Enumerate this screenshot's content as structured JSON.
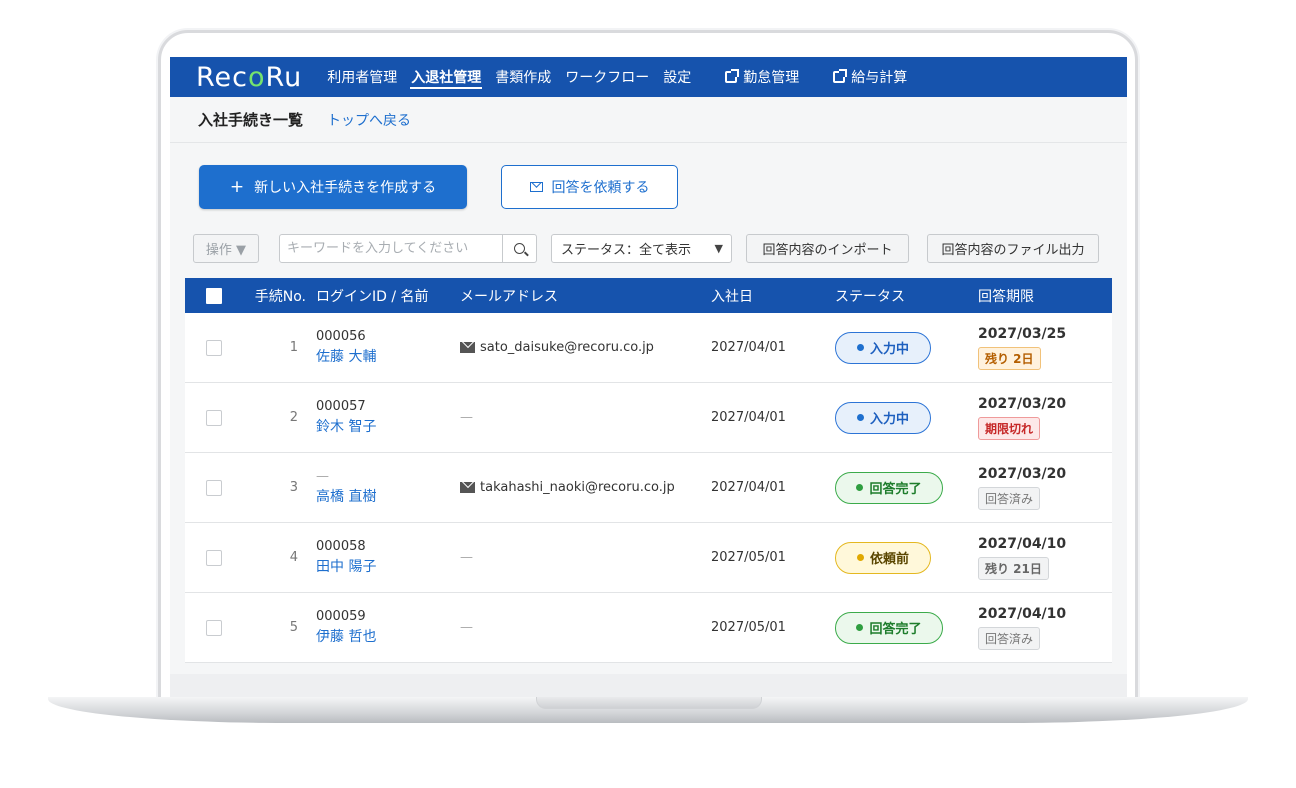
{
  "app": {
    "logo": {
      "part1": "Rec",
      "part2": "o",
      "part3": "Ru"
    },
    "nav": [
      {
        "label": "利用者管理",
        "active": false
      },
      {
        "label": "入退社管理",
        "active": true
      },
      {
        "label": "書類作成",
        "active": false
      },
      {
        "label": "ワークフロー",
        "active": false
      },
      {
        "label": "設定",
        "active": false
      }
    ],
    "external_nav": [
      {
        "label": "勤怠管理"
      },
      {
        "label": "給与計算"
      }
    ]
  },
  "subheader": {
    "title": "入社手続き一覧",
    "back_link": "トップへ戻る"
  },
  "actions": {
    "create_label": "新しい入社手続きを作成する",
    "create_icon": "+",
    "request_label": "回答を依頼する"
  },
  "filters": {
    "ops_label": "操作 ▼",
    "search_placeholder": "キーワードを入力してください",
    "status_label": "ステータス：全て表示",
    "import_label": "回答内容のインポート",
    "export_label": "回答内容のファイル出力"
  },
  "table": {
    "columns": [
      "手続No.",
      "ログインID / 名前",
      "メールアドレス",
      "入社日",
      "ステータス",
      "回答期限"
    ],
    "rows": [
      {
        "no": "1",
        "login_id": "000056",
        "name": "佐藤 大輔",
        "email": "sato_daisuke@recoru.co.jp",
        "join_date": "2027/04/01",
        "status": "入力中",
        "deadline": "2027/03/25",
        "tag": "残り 2日"
      },
      {
        "no": "2",
        "login_id": "000057",
        "name": "鈴木 智子",
        "email": "—",
        "join_date": "2027/04/01",
        "status": "入力中",
        "deadline": "2027/03/20",
        "tag": "期限切れ"
      },
      {
        "no": "3",
        "login_id": "—",
        "name": "高橋 直樹",
        "email": "takahashi_naoki@recoru.co.jp",
        "join_date": "2027/04/01",
        "status": "回答完了",
        "deadline": "2027/03/20",
        "tag": "回答済み"
      },
      {
        "no": "4",
        "login_id": "000058",
        "name": "田中 陽子",
        "email": "—",
        "join_date": "2027/05/01",
        "status": "依頼前",
        "deadline": "2027/04/10",
        "tag": "残り 21日"
      },
      {
        "no": "5",
        "login_id": "000059",
        "name": "伊藤 哲也",
        "email": "—",
        "join_date": "2027/05/01",
        "status": "回答完了",
        "deadline": "2027/04/10",
        "tag": "回答済み"
      }
    ]
  },
  "colors": {
    "navbar": "#1653ad",
    "primary": "#1e6fce",
    "logo_accent": "#76e36d",
    "status_input": "#1e6fce",
    "status_done": "#2f9e40",
    "status_before": "#e0a800"
  }
}
